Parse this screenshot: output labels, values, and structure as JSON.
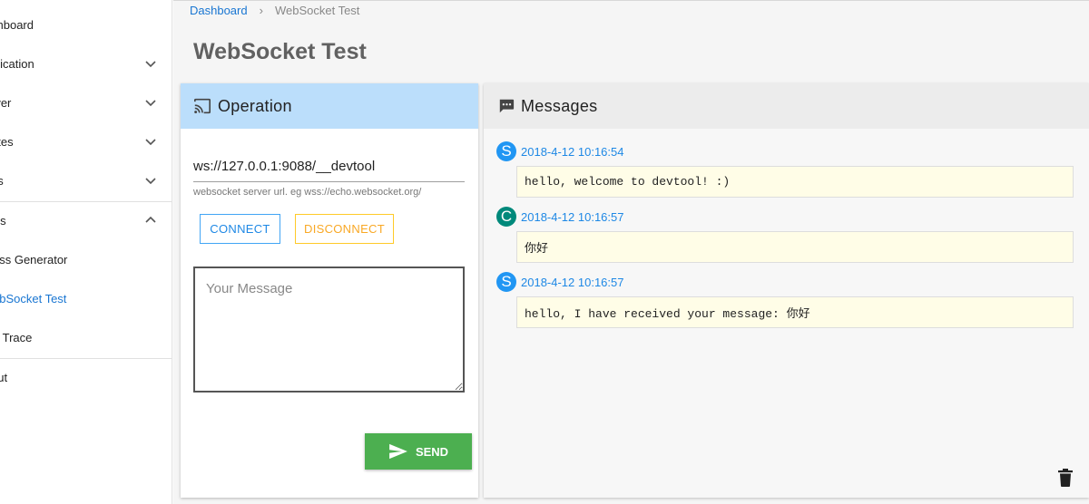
{
  "sidebar": {
    "items": [
      {
        "label": "shboard"
      },
      {
        "label": "plication"
      },
      {
        "label": "rver"
      },
      {
        "label": "utes"
      },
      {
        "label": "gs"
      },
      {
        "label": "ols"
      },
      {
        "label": "ass Generator"
      },
      {
        "label": "ebSocket Test"
      },
      {
        "label": "n Trace"
      },
      {
        "label": "out"
      }
    ]
  },
  "breadcrumb": {
    "home": "Dashboard",
    "separator": "›",
    "current": "WebSocket Test"
  },
  "page_title": "WebSocket Test",
  "operation": {
    "title": "Operation",
    "url_value": "ws://127.0.0.1:9088/__devtool",
    "url_hint": "websocket server url. eg wss://echo.websocket.org/",
    "connect_label": "CONNECT",
    "disconnect_label": "DISCONNECT",
    "message_placeholder": "Your Message",
    "send_label": "SEND"
  },
  "messages": {
    "title": "Messages",
    "items": [
      {
        "avatar": "S",
        "time": "2018-4-12 10:16:54",
        "text": "hello, welcome to devtool! :)"
      },
      {
        "avatar": "C",
        "time": "2018-4-12 10:16:57",
        "text": "你好"
      },
      {
        "avatar": "S",
        "time": "2018-4-12 10:16:57",
        "text": "hello, I have received your message: 你好"
      }
    ]
  },
  "colors": {
    "accent": "#1976d2",
    "operation_header": "#bbdefb",
    "send_button": "#4caf50",
    "connect_border": "#42a5f5",
    "disconnect_border": "#ffca28",
    "server_avatar": "#2196f3",
    "client_avatar": "#00897b",
    "bubble_bg": "#fffde7"
  },
  "icons": [
    "chevron-down-icon",
    "chevron-up-icon",
    "cast-icon",
    "chat-icon",
    "send-icon",
    "trash-icon"
  ]
}
